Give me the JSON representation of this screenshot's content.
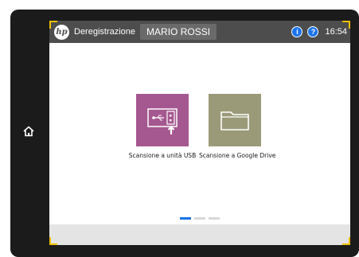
{
  "header": {
    "logo": "hp",
    "logout_label": "Deregistrazione",
    "user_name": "MARIO ROSSI",
    "info_icon": "i",
    "help_icon": "?",
    "time": "16:54"
  },
  "tiles": [
    {
      "label": "Scansione a unità USB",
      "icon": "usb-icon",
      "color": "#a5578f"
    },
    {
      "label": "Scansione a Google Drive",
      "icon": "folder-icon",
      "color": "#9a9a78"
    }
  ],
  "pagination": {
    "pages": 3,
    "current": 1
  },
  "colors": {
    "header_bg": "#4d4d4d",
    "accent_blue": "#1a73e8",
    "corner_highlight": "#f0c000"
  }
}
